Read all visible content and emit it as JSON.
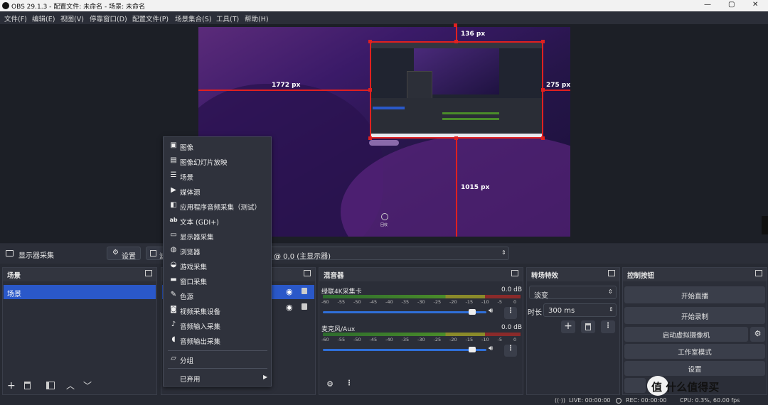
{
  "window": {
    "title": "OBS 29.1.3 - 配置文件: 未命名 - 场景: 未命名",
    "minimize": "—",
    "maximize": "▢",
    "close": "✕"
  },
  "menu": [
    "文件(F)",
    "编辑(E)",
    "视图(V)",
    "停靠窗口(D)",
    "配置文件(P)",
    "场景集合(S)",
    "工具(T)",
    "帮助(H)"
  ],
  "preview": {
    "measure_top": "136 px",
    "measure_left": "1772 px",
    "measure_right": "275 px",
    "measure_bottom": "1015 px",
    "desktop_icon_label": "回收"
  },
  "source_bar": {
    "source_name": "显示器采集",
    "settings_label": "设置",
    "filter_label": "滤",
    "display_value": "@ 0,0 (主显示器)"
  },
  "scenes": {
    "title": "场景",
    "items": [
      "场景"
    ]
  },
  "mixer": {
    "title": "混音器",
    "ticks": [
      "-60",
      "-55",
      "-50",
      "-45",
      "-40",
      "-35",
      "-30",
      "-25",
      "-20",
      "-15",
      "-10",
      "-5",
      "0"
    ],
    "channels": [
      {
        "name": "绿联4K采集卡",
        "db": "0.0 dB",
        "volume": 0.92
      },
      {
        "name": "麦克风/Aux",
        "db": "0.0 dB",
        "volume": 0.92
      }
    ]
  },
  "transitions": {
    "title": "转场特效",
    "type": "淡变",
    "duration_label": "时长",
    "duration_value": "300 ms"
  },
  "controls": {
    "title": "控制按钮",
    "start_stream": "开始直播",
    "start_record": "开始录制",
    "virtual_cam": "启动虚拟摄像机",
    "studio_mode": "工作室模式",
    "settings": "设置"
  },
  "context_menu": {
    "items": [
      {
        "label": "图像",
        "icon": "image-icon"
      },
      {
        "label": "图像幻灯片放映",
        "icon": "slideshow-icon"
      },
      {
        "label": "场景",
        "icon": "list-icon"
      },
      {
        "label": "媒体源",
        "icon": "play-icon"
      },
      {
        "label": "应用程序音频采集（测试）",
        "icon": "app-audio-icon"
      },
      {
        "label": "文本 (GDI+)",
        "icon": "text-icon"
      },
      {
        "label": "显示器采集",
        "icon": "monitor-icon"
      },
      {
        "label": "浏览器",
        "icon": "globe-icon"
      },
      {
        "label": "游戏采集",
        "icon": "gamepad-icon"
      },
      {
        "label": "窗口采集",
        "icon": "window-icon"
      },
      {
        "label": "色源",
        "icon": "brush-icon"
      },
      {
        "label": "视频采集设备",
        "icon": "camera-icon"
      },
      {
        "label": "音频输入采集",
        "icon": "mic-icon"
      },
      {
        "label": "音频输出采集",
        "icon": "speaker-icon"
      }
    ],
    "group_label": "分组",
    "deprecated_label": "已弃用"
  },
  "status": {
    "live": "LIVE: 00:00:00",
    "rec": "REC: 00:00:00",
    "cpu": "CPU: 0.3%, 60.00 fps"
  },
  "watermark": "值 什么值得买",
  "colors": {
    "accent": "#2a58c9",
    "guide": "#e02020",
    "panel": "#2b2e38"
  }
}
